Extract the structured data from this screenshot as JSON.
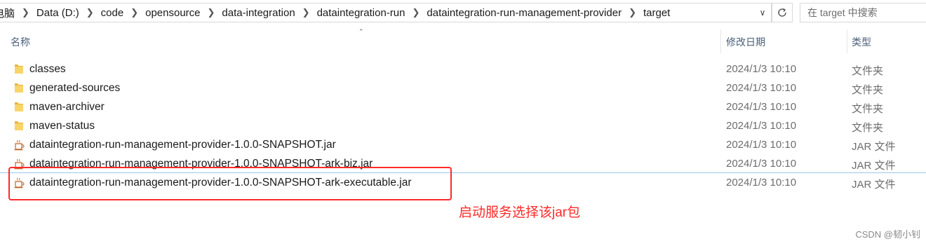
{
  "breadcrumbs": [
    "电脑",
    "Data (D:)",
    "code",
    "opensource",
    "data-integration",
    "dataintegration-run",
    "dataintegration-run-management-provider",
    "target"
  ],
  "search": {
    "placeholder": "在 target 中搜索"
  },
  "columns": {
    "name": "名称",
    "modified": "修改日期",
    "type": "类型"
  },
  "files": [
    {
      "icon": "folder-icon",
      "name": "classes",
      "modified": "2024/1/3 10:10",
      "type": "文件夹"
    },
    {
      "icon": "folder-icon",
      "name": "generated-sources",
      "modified": "2024/1/3 10:10",
      "type": "文件夹"
    },
    {
      "icon": "folder-icon",
      "name": "maven-archiver",
      "modified": "2024/1/3 10:10",
      "type": "文件夹"
    },
    {
      "icon": "folder-icon",
      "name": "maven-status",
      "modified": "2024/1/3 10:10",
      "type": "文件夹"
    },
    {
      "icon": "jar-icon",
      "name": "dataintegration-run-management-provider-1.0.0-SNAPSHOT.jar",
      "modified": "2024/1/3 10:10",
      "type": "JAR 文件"
    },
    {
      "icon": "jar-icon",
      "name": "dataintegration-run-management-provider-1.0.0-SNAPSHOT-ark-biz.jar",
      "modified": "2024/1/3 10:10",
      "type": "JAR 文件"
    },
    {
      "icon": "jar-icon",
      "name": "dataintegration-run-management-provider-1.0.0-SNAPSHOT-ark-executable.jar",
      "modified": "2024/1/3 10:10",
      "type": "JAR 文件"
    }
  ],
  "annotation": {
    "text": "启动服务选择该jar包",
    "color": "#ff2a2a"
  },
  "watermark": "CSDN @韧小钊"
}
